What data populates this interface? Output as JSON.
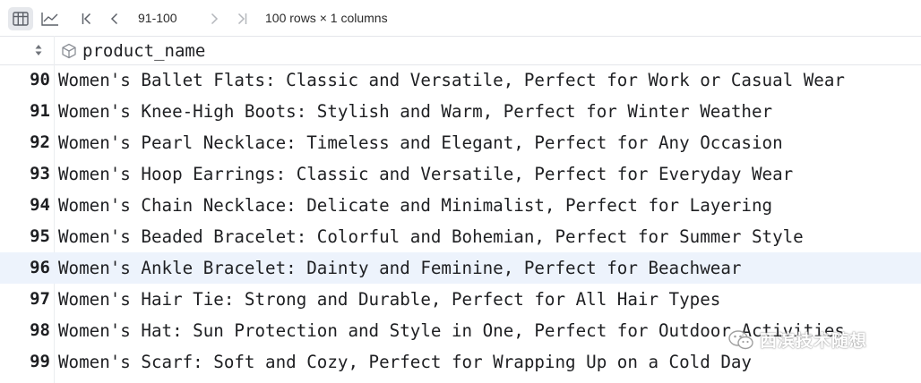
{
  "toolbar": {
    "table_view_icon": "table-grid-icon",
    "chart_view_icon": "line-chart-icon",
    "first_page_icon": "first-page-icon",
    "prev_page_icon": "chevron-left-icon",
    "page_range": "91-100",
    "next_page_icon": "chevron-right-icon",
    "last_page_icon": "last-page-icon",
    "summary": "100 rows × 1 columns"
  },
  "header": {
    "sort_icon": "sort-updown-icon",
    "column_icon": "cube-icon",
    "column_name": "product_name"
  },
  "rows": [
    {
      "num": "90",
      "text": "Women's Ballet Flats: Classic and Versatile, Perfect for Work or Casual Wear"
    },
    {
      "num": "91",
      "text": "Women's Knee-High Boots: Stylish and Warm, Perfect for Winter Weather"
    },
    {
      "num": "92",
      "text": "Women's Pearl Necklace: Timeless and Elegant, Perfect for Any Occasion"
    },
    {
      "num": "93",
      "text": "Women's Hoop Earrings: Classic and Versatile, Perfect for Everyday Wear"
    },
    {
      "num": "94",
      "text": "Women's Chain Necklace: Delicate and Minimalist, Perfect for Layering"
    },
    {
      "num": "95",
      "text": "Women's Beaded Bracelet: Colorful and Bohemian, Perfect for Summer Style"
    },
    {
      "num": "96",
      "text": "Women's Ankle Bracelet: Dainty and Feminine, Perfect for Beachwear"
    },
    {
      "num": "97",
      "text": "Women's Hair Tie: Strong and Durable, Perfect for All Hair Types"
    },
    {
      "num": "98",
      "text": "Women's Hat: Sun Protection and Style in One, Perfect for Outdoor Activities"
    },
    {
      "num": "99",
      "text": "Women's Scarf: Soft and Cozy, Perfect for Wrapping Up on a Cold Day"
    }
  ],
  "selected_row": "96",
  "watermark": {
    "icon": "wechat-logo-icon",
    "text": "西滨技术随想"
  },
  "colors": {
    "selected_row_bg": "#edf3fc",
    "active_toggle_bg": "#e6e8ec",
    "text": "#1e1f22",
    "icon": "#6f737a"
  }
}
